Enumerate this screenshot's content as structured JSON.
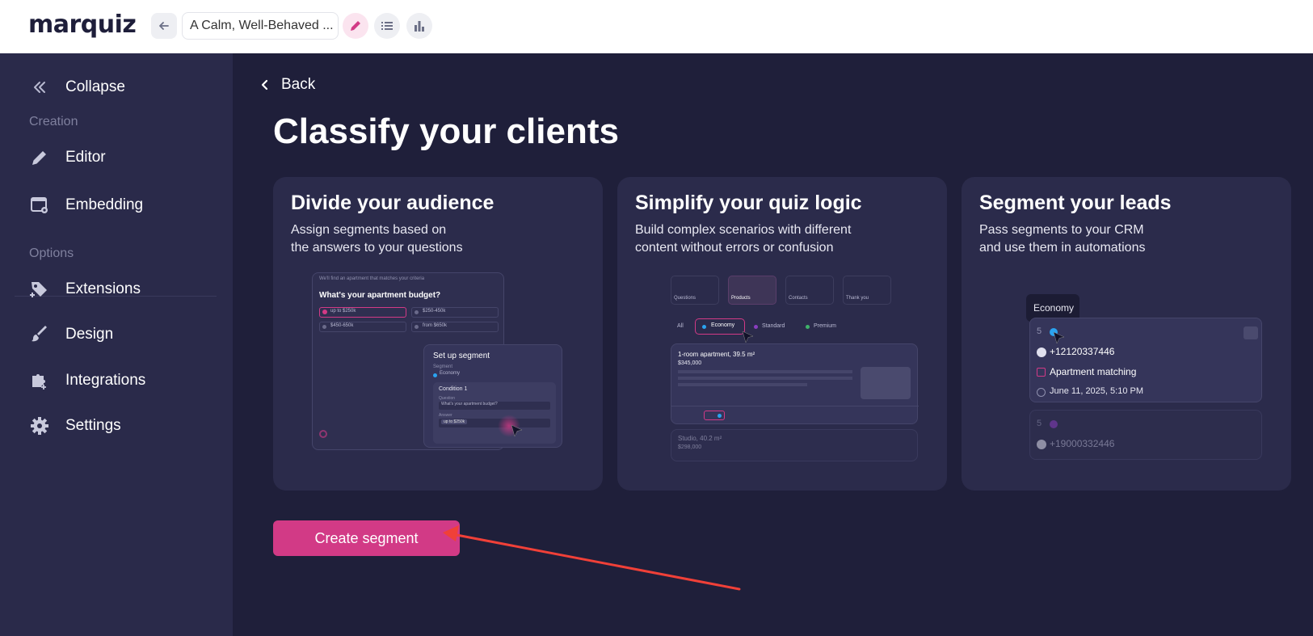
{
  "app": {
    "logo": "marquiz"
  },
  "topbar": {
    "quiz_title": "A Calm, Well-Behaved ..."
  },
  "sidebar": {
    "collapse_label": "Collapse",
    "section_creation": "Creation",
    "editor_label": "Editor",
    "embedding_label": "Embedding",
    "section_options": "Options",
    "extensions_label": "Extensions",
    "design_label": "Design",
    "integrations_label": "Integrations",
    "settings_label": "Settings"
  },
  "main": {
    "back_label": "Back",
    "title": "Classify your clients",
    "cards": [
      {
        "title": "Divide your audience",
        "desc_line1": "Assign segments based on",
        "desc_line2": "the answers to your questions"
      },
      {
        "title": "Simplify your quiz logic",
        "desc_line1": "Build complex scenarios with different",
        "desc_line2": "content without errors or confusion"
      },
      {
        "title": "Segment your leads",
        "desc_line1": "Pass segments to your CRM",
        "desc_line2": "and use them in automations"
      }
    ],
    "cta_label": "Create segment"
  },
  "illustration1": {
    "header": "We'll find an apartment that matches your criteria",
    "question": "What's your apartment budget?",
    "options": [
      "up to $250k",
      "$250-450k",
      "$450-650k",
      "from $650k"
    ],
    "setup_title": "Set up segment",
    "segment_label": "Segment",
    "segment_value": "Economy",
    "condition": "Condition 1",
    "question_label": "Question",
    "question_value": "What's your apartment budget?",
    "answer_label": "Answer",
    "answer_value": "up to $250k"
  },
  "illustration2": {
    "steps": [
      "Questions",
      "Products",
      "Contacts",
      "Thank you"
    ],
    "filters": [
      "All",
      "Economy",
      "Standard",
      "Premium"
    ],
    "product_title": "1-room apartment, 39.5 m²",
    "product_price": "$345,000",
    "product2_title": "Studio, 40.2 m²",
    "product2_price": "$298,000"
  },
  "illustration3": {
    "tooltip": "Economy",
    "lead1_num": "5",
    "phone1": "+12120337446",
    "tag": "Apartment matching",
    "date": "June 11, 2025, 5:10 PM",
    "lead2_num": "5",
    "phone2": "+19000332446"
  },
  "colors": {
    "accent": "#d23a86",
    "sidebar_bg": "#2a2a4a",
    "main_bg": "#1f1f3a",
    "card_bg": "#2b2b4b",
    "annotation_arrow": "#f04038"
  }
}
